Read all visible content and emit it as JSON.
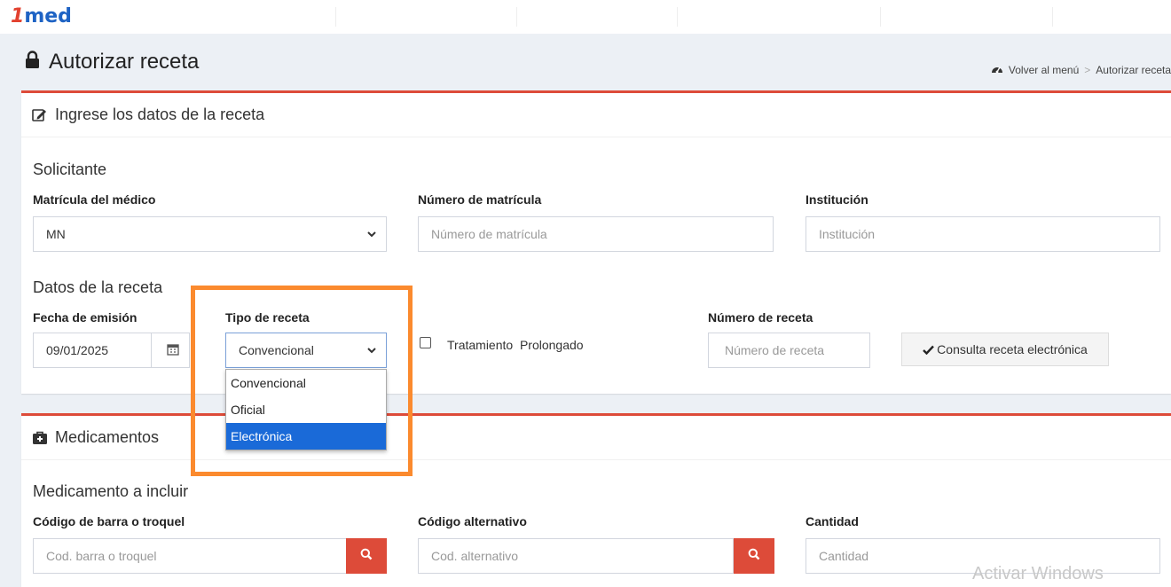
{
  "app": {
    "logo_num": "1",
    "logo_text": "med"
  },
  "page": {
    "title": "Autorizar receta",
    "breadcrumb": {
      "home": "Volver al menú",
      "separator": ">",
      "current": "Autorizar receta"
    }
  },
  "receta_box": {
    "header": "Ingrese los datos de la receta",
    "solicitante": {
      "section": "Solicitante",
      "matricula_medico": {
        "label": "Matrícula del médico",
        "value": "MN"
      },
      "numero_matricula": {
        "label": "Número de matrícula",
        "placeholder": "Número de matrícula"
      },
      "institucion": {
        "label": "Institución",
        "placeholder": "Institución"
      }
    },
    "datos": {
      "section": "Datos de la receta",
      "fecha": {
        "label": "Fecha de emisión",
        "value": "09/01/2025"
      },
      "tipo": {
        "label": "Tipo de receta",
        "value": "Convencional",
        "options": [
          "Convencional",
          "Oficial",
          "Electrónica"
        ],
        "highlighted_option": "Electrónica"
      },
      "tratamiento": {
        "label": "Tratamiento  Prolongado",
        "checked": false
      },
      "numero_receta": {
        "label": "Número de receta",
        "placeholder": "Número de receta"
      },
      "consulta_button": "Consulta receta electrónica"
    }
  },
  "medicamentos_box": {
    "header": "Medicamentos",
    "section": "Medicamento a incluir",
    "codigo_barra": {
      "label": "Código de barra o troquel",
      "placeholder": "Cod. barra o troquel"
    },
    "codigo_alternativo": {
      "label": "Código alternativo",
      "placeholder": "Cod. alternativo"
    },
    "cantidad": {
      "label": "Cantidad",
      "placeholder": "Cantidad"
    }
  },
  "watermark": "Activar Windows",
  "colors": {
    "accent_red": "#dd4b39",
    "highlight_orange": "#fb8a2e",
    "selected_blue": "#1a6ad8",
    "brand_blue": "#1e63c4"
  },
  "icons": [
    "lock-icon",
    "dashboard-icon",
    "edit-icon",
    "calendar-icon",
    "chevron-down-icon",
    "check-icon",
    "medkit-icon",
    "search-icon"
  ]
}
